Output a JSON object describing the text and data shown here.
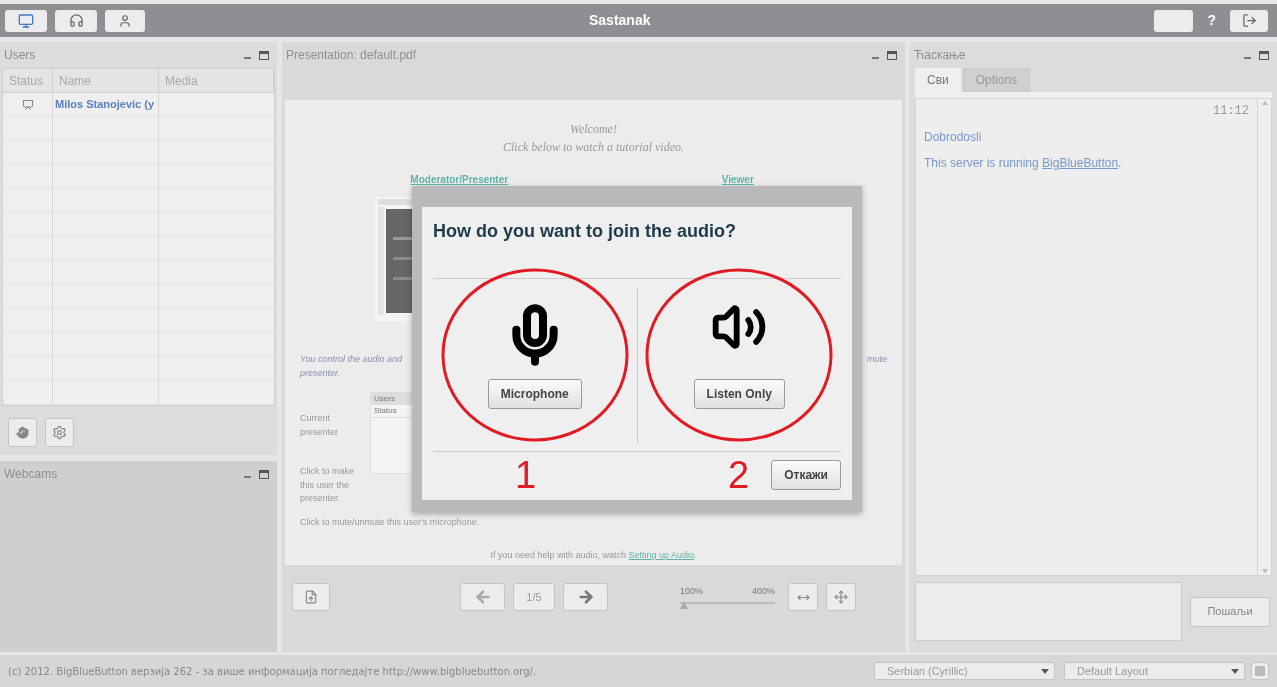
{
  "top_bar": {
    "title": "Sastanak",
    "help": "?"
  },
  "users_panel": {
    "title": "Users",
    "columns": [
      "Status",
      "Name",
      "Media"
    ],
    "rows": [
      {
        "name": "Milos Stanojevic (y"
      }
    ]
  },
  "webcams_panel": {
    "title": "Webcams"
  },
  "presentation": {
    "title": "Presentation: default.pdf",
    "slide": {
      "welcome": "Welcome!",
      "intro": "Click below to watch a tutorial video.",
      "links": [
        "Moderator/Presenter",
        "Viewer"
      ],
      "audio_left": "You control the audio and",
      "audio_left_2": "presenter.",
      "audio_right": "mute",
      "mini_table": [
        "Users",
        "Status"
      ],
      "current": "Current presenter",
      "make": "Click to make this user the presenter.",
      "mute_hint": "Click to mute/unmute this user's microphone.",
      "help": "If you need help with audio, watch ",
      "help_link": "Setting up Audio",
      "help_end": "."
    },
    "page": "1/5",
    "zoom_min": "100%",
    "zoom_max": "400%",
    "zoom": {
      "level": 0
    }
  },
  "chat": {
    "title": "Ћаскање",
    "tabs": [
      {
        "label": "Сви",
        "selected": true
      },
      {
        "label": "Options",
        "selected": false
      }
    ],
    "time": "11:12",
    "messages": [
      {
        "text": "Dobrodosli"
      },
      {
        "text": "This server is running ",
        "link": "BigBlueButton",
        "suffix": "."
      }
    ],
    "send": "Пошаљи"
  },
  "dialog": {
    "title": "How do you want to join the audio?",
    "options": [
      {
        "kind": "microphone",
        "label": "Microphone",
        "annotation": "1"
      },
      {
        "kind": "listen",
        "label": "Listen Only",
        "annotation": "2"
      }
    ],
    "cancel": "Откажи"
  },
  "footer": {
    "copyright": "(c) 2012. BigBlueButton верзија 262 - за више информација погледајте http://www.bigbluebutton.org/.",
    "language": "Serbian (Cyrillic)",
    "layout": "Default Layout"
  }
}
